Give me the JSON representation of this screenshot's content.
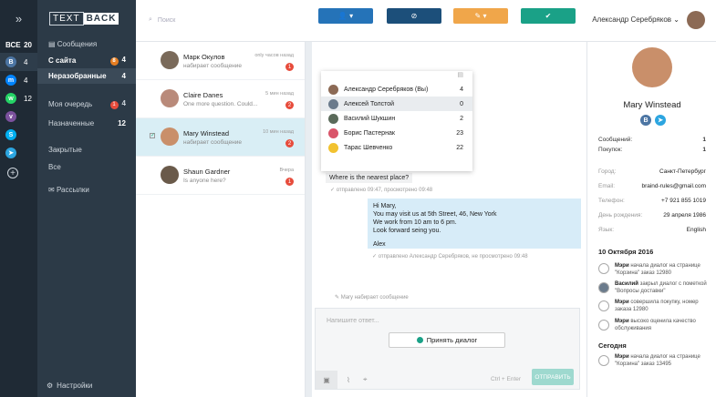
{
  "rail": {
    "all_label": "ВСЕ",
    "all_count": "20",
    "channels": [
      {
        "icon": "vk-icon",
        "count": "4",
        "color": "#4c75a3"
      },
      {
        "icon": "messenger-icon",
        "count": "4",
        "color": "#0084ff"
      },
      {
        "icon": "whatsapp-icon",
        "count": "12",
        "color": "#25d366"
      },
      {
        "icon": "viber-icon",
        "count": "",
        "color": "#7b519d"
      },
      {
        "icon": "skype-icon",
        "count": "",
        "color": "#00aff0"
      },
      {
        "icon": "telegram-icon",
        "count": "",
        "color": "#2ca5e0"
      }
    ]
  },
  "nav": {
    "logo_a": "TEXT",
    "logo_b": "BACK",
    "messages": "Сообщения",
    "from_site": "С сайта",
    "from_site_count": "4",
    "from_site_badge": "8",
    "unsorted": "Неразобранные",
    "unsorted_count": "4",
    "my_queue": "Моя очередь",
    "my_queue_count": "4",
    "my_queue_badge": "1",
    "assigned": "Назначенные",
    "assigned_count": "12",
    "closed": "Закрытые",
    "all": "Все",
    "mailings": "Рассылки",
    "settings": "Настройки"
  },
  "header": {
    "search_placeholder": "Поиск",
    "user": "Александр Серебряков"
  },
  "list": [
    {
      "name": "Марк Окулов",
      "preview": "набирает сообщение",
      "time": "only часов назад",
      "count": "1"
    },
    {
      "name": "Claire Danes",
      "preview": "One more question. Could...",
      "time": "5 мин назад",
      "count": "2"
    },
    {
      "name": "Mary Winstead",
      "preview": "набирает сообщение",
      "time": "10 мин назад",
      "count": "2"
    },
    {
      "name": "Shaun Gardner",
      "preview": "Is anyone here?",
      "time": "Вчера",
      "count": "1"
    }
  ],
  "dropdown": [
    {
      "name": "Александр Серебряков (Вы)",
      "n": "4"
    },
    {
      "name": "Алексей Толстой",
      "n": "0"
    },
    {
      "name": "Василий Шукшин",
      "n": "2"
    },
    {
      "name": "Борис Пастернак",
      "n": "23"
    },
    {
      "name": "Тарас Шевченко",
      "n": "22"
    }
  ],
  "chat": {
    "prev_tail": "Where is the nearest place?",
    "prev_meta": "отправлено 09:47, просмотрено 09:48",
    "msg": [
      "Hi Mary,",
      "You may visit us at 5th Street, 46, New York",
      "We work from 10 am to 6 pm.",
      "Look forward seing you.",
      "Alex"
    ],
    "msg_meta": "отправлено Александр Серебряков, не просмотрено 09:48",
    "typing": "Mary набирает сообщение",
    "compose_placeholder": "Напишите ответ...",
    "accept": "Принять диалог",
    "hint": "Ctrl + Enter",
    "send": "ОТПРАВИТЬ"
  },
  "profile": {
    "name": "Mary Winstead",
    "messages_k": "Сообщений:",
    "messages_v": "1",
    "purchases_k": "Покупок:",
    "purchases_v": "1",
    "city_k": "Город:",
    "city_v": "Санкт-Петербург",
    "email_k": "Email:",
    "email_v": "braind-rules@gmail.com",
    "phone_k": "Телефон:",
    "phone_v": "+7 921 855 1019",
    "bday_k": "День рождения:",
    "bday_v": "29 апреля 1986",
    "lang_k": "Язык:",
    "lang_v": "English",
    "date1": "10 Октября 2016",
    "date2": "Сегодня",
    "events": [
      {
        "who": "Мэри",
        "text": "начала диалог на странице \"Корзина\" заказ 12980"
      },
      {
        "who": "Василий",
        "text": "закрыл диалог с пометкой \"Вопросы доставки\""
      },
      {
        "who": "Мэри",
        "text": "совершила покупку, номер заказа 12980"
      },
      {
        "who": "Мэри",
        "text": "высоко оценила качество обслуживания"
      },
      {
        "who": "Мэри",
        "text": "начала диалог на странице \"Корзина\" заказ 13495"
      }
    ]
  }
}
